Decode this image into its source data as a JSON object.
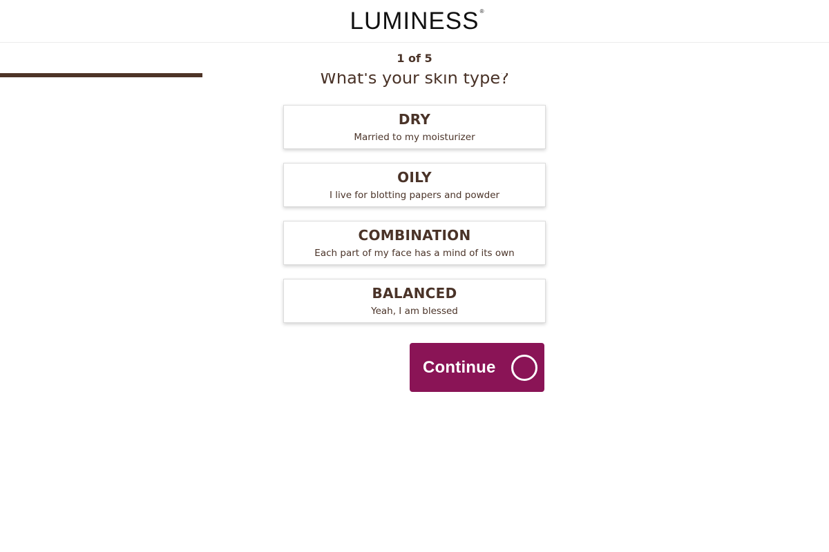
{
  "header": {
    "logo_text": "LUMINESS",
    "logo_mark": "®"
  },
  "quiz": {
    "step_text": "1 of 5",
    "progress_fraction": 0.2442,
    "question": "What's your skin type?",
    "options": [
      {
        "title": "DRY",
        "description": "Married to my moisturizer"
      },
      {
        "title": "OILY",
        "description": "I live for blotting papers and powder"
      },
      {
        "title": "COMBINATION",
        "description": "Each part of my face has a mind of its own"
      },
      {
        "title": "BALANCED",
        "description": "Yeah, I am blessed"
      }
    ],
    "continue_label": "Continue",
    "continue_icon": "circle-icon"
  },
  "colors": {
    "brand_brown": "#4e3427",
    "accent_plum": "#8a1456",
    "text_brown": "#4a3328"
  }
}
